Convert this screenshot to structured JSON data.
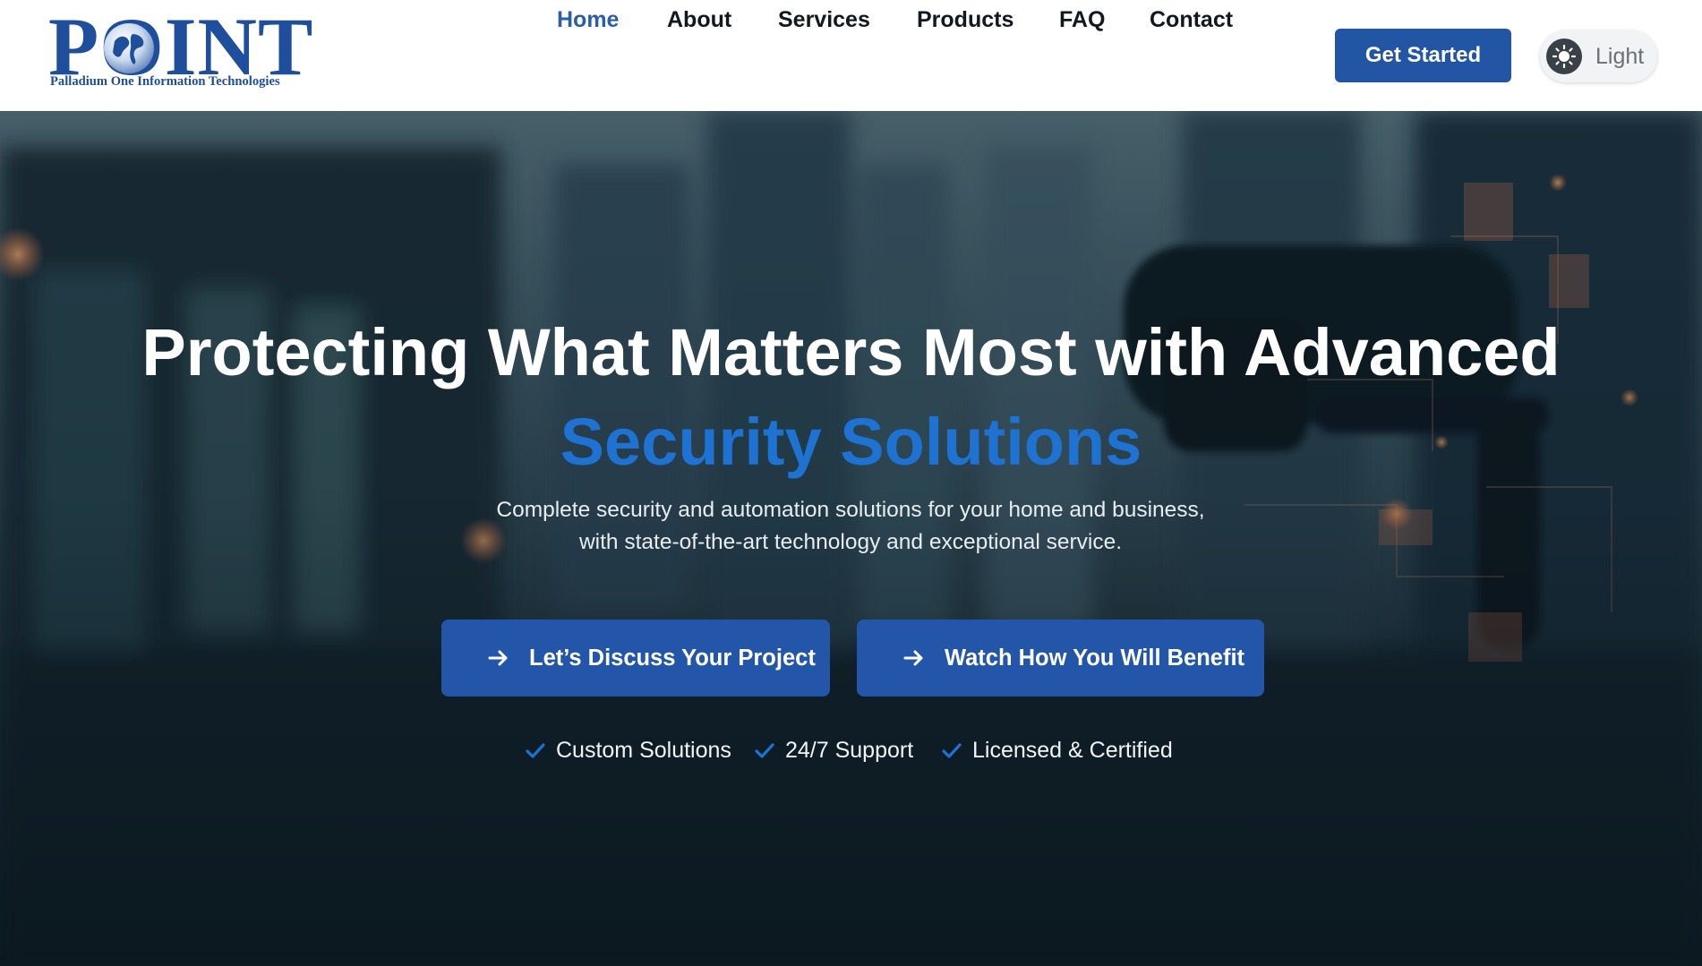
{
  "header": {
    "logo": {
      "word": "POINT",
      "tagline": "Palladium One Information Technologies"
    },
    "nav": [
      {
        "label": "Home",
        "active": true
      },
      {
        "label": "About",
        "active": false
      },
      {
        "label": "Services",
        "active": false
      },
      {
        "label": "Products",
        "active": false
      },
      {
        "label": "FAQ",
        "active": false
      },
      {
        "label": "Contact",
        "active": false
      }
    ],
    "cta_label": "Get Started",
    "theme_toggle": {
      "label": "Light",
      "icon": "sun-icon"
    }
  },
  "hero": {
    "title_line1": "Protecting What Matters Most with Advanced",
    "title_line2": "Security Solutions",
    "subtitle": "Complete security and automation solutions for your home and business, with state-of-the-art technology and exceptional service.",
    "buttons": [
      {
        "label": "Let’s Discuss Your Project",
        "icon": "arrow-right-icon"
      },
      {
        "label": "Watch How You Will Benefit",
        "icon": "arrow-right-icon"
      }
    ],
    "features": [
      {
        "label": "Custom Solutions",
        "icon": "check-icon"
      },
      {
        "label": "24/7 Support",
        "icon": "check-icon"
      },
      {
        "label": "Licensed & Certified",
        "icon": "check-icon"
      }
    ]
  },
  "colors": {
    "brand_blue": "#1f4e9c",
    "button_blue": "#2255a4",
    "accent_blue": "#1e72d2",
    "active_nav": "#2b5da8"
  }
}
